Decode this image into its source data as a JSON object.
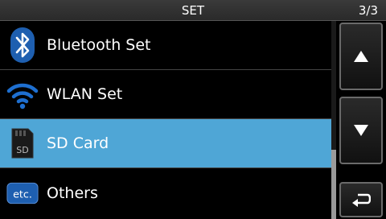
{
  "header": {
    "title": "SET",
    "page": "3/3"
  },
  "menu": {
    "items": [
      {
        "label": "Bluetooth Set",
        "icon": "bluetooth-icon"
      },
      {
        "label": "WLAN Set",
        "icon": "wifi-icon"
      },
      {
        "label": "SD Card",
        "icon": "sd-card-icon",
        "selected": true,
        "icon_text": "SD"
      },
      {
        "label": "Others",
        "icon": "etc-icon",
        "icon_text": "etc."
      }
    ]
  },
  "controls": {
    "up_icon": "up-arrow-icon",
    "down_icon": "down-arrow-icon",
    "back_icon": "back-return-icon"
  },
  "colors": {
    "selected": "#4fa6d6",
    "accent_blue": "#1e6fd0"
  }
}
